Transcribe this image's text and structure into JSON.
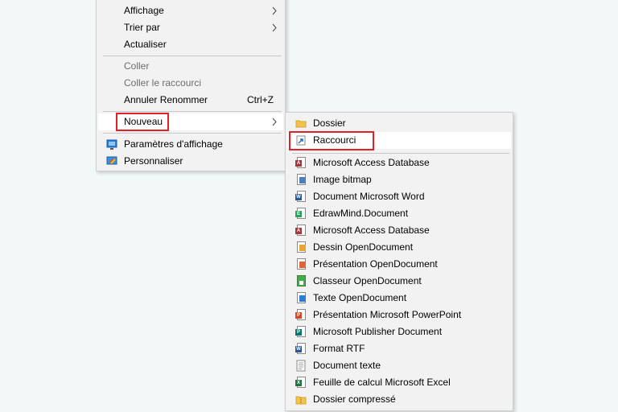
{
  "context_menu": {
    "items": [
      {
        "label": "Affichage"
      },
      {
        "label": "Trier par"
      },
      {
        "label": "Actualiser"
      },
      {
        "label": "Coller"
      },
      {
        "label": "Coller le raccourci"
      },
      {
        "label": "Annuler Renommer",
        "shortcut": "Ctrl+Z"
      },
      {
        "label": "Nouveau"
      },
      {
        "label": "Paramètres d'affichage"
      },
      {
        "label": "Personnaliser"
      }
    ]
  },
  "new_submenu": {
    "items": [
      {
        "label": "Dossier",
        "icon": "folder-icon"
      },
      {
        "label": "Raccourci",
        "icon": "shortcut-icon"
      },
      {
        "label": "Microsoft Access Database",
        "icon": "access-icon"
      },
      {
        "label": "Image bitmap",
        "icon": "bitmap-icon"
      },
      {
        "label": "Document Microsoft Word",
        "icon": "word-icon"
      },
      {
        "label": "EdrawMind.Document",
        "icon": "edrawmind-icon"
      },
      {
        "label": "Microsoft Access Database",
        "icon": "access-icon"
      },
      {
        "label": "Dessin OpenDocument",
        "icon": "odg-icon"
      },
      {
        "label": "Présentation OpenDocument",
        "icon": "odp-icon"
      },
      {
        "label": "Classeur OpenDocument",
        "icon": "ods-icon"
      },
      {
        "label": "Texte OpenDocument",
        "icon": "odt-icon"
      },
      {
        "label": "Présentation Microsoft PowerPoint",
        "icon": "powerpoint-icon"
      },
      {
        "label": "Microsoft Publisher Document",
        "icon": "publisher-icon"
      },
      {
        "label": "Format RTF",
        "icon": "rtf-icon"
      },
      {
        "label": "Document texte",
        "icon": "text-document-icon"
      },
      {
        "label": "Feuille de calcul Microsoft Excel",
        "icon": "excel-icon"
      },
      {
        "label": "Dossier compressé",
        "icon": "zip-folder-icon"
      }
    ]
  },
  "colors": {
    "highlight_box": "#e3202a",
    "menu_background": "#f2f2f2",
    "desktop_background": "#f1f8f7"
  }
}
